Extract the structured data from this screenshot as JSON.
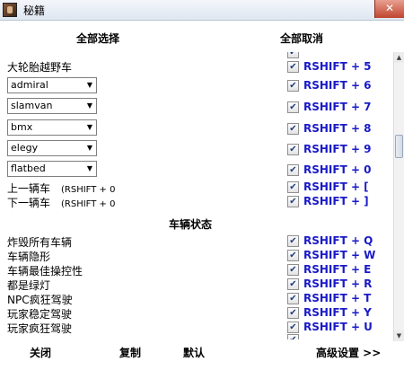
{
  "window": {
    "title": "秘籍",
    "close_glyph": "✕"
  },
  "header": {
    "select_all": "全部选择",
    "deselect_all": "全部取消"
  },
  "rows": [
    {
      "type": "text",
      "left": "大轮胎越野车",
      "key": "RSHIFT + 5"
    },
    {
      "type": "select",
      "value": "admiral",
      "key": "RSHIFT + 6"
    },
    {
      "type": "select",
      "value": "slamvan",
      "key": "RSHIFT + 7"
    },
    {
      "type": "select",
      "value": "bmx",
      "key": "RSHIFT + 8"
    },
    {
      "type": "select",
      "value": "elegy",
      "key": "RSHIFT + 9"
    },
    {
      "type": "select",
      "value": "flatbed",
      "key": "RSHIFT + 0"
    },
    {
      "type": "text",
      "left": "上一辆车",
      "shortcut": "(RSHIFT + 0",
      "key": "RSHIFT + ["
    },
    {
      "type": "text",
      "left": "下一辆车",
      "shortcut": "(RSHIFT + 0",
      "key": "RSHIFT + ]"
    }
  ],
  "section": {
    "title": "车辆状态"
  },
  "status_rows": [
    {
      "left": "炸毁所有车辆",
      "key": "RSHIFT + Q"
    },
    {
      "left": "车辆隐形",
      "key": "RSHIFT + W"
    },
    {
      "left": "车辆最佳操控性",
      "key": "RSHIFT + E"
    },
    {
      "left": "都是绿灯",
      "key": "RSHIFT + R"
    },
    {
      "left": "NPC疯狂驾驶",
      "key": "RSHIFT + T"
    },
    {
      "left": "玩家稳定驾驶",
      "key": "RSHIFT + Y"
    },
    {
      "left": "玩家疯狂驾驶",
      "key": "RSHIFT + U"
    }
  ],
  "bottom": {
    "close": "关闭",
    "copy": "复制",
    "default": "默认",
    "advanced": "高级设置 >>"
  },
  "colors": {
    "key_text": "#1a1ac8"
  }
}
